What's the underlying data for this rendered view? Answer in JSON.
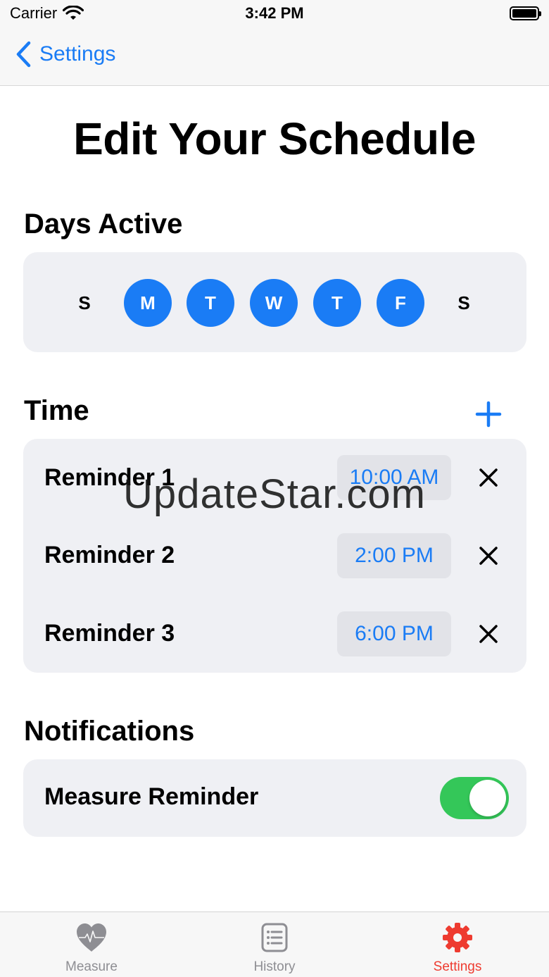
{
  "status_bar": {
    "carrier": "Carrier",
    "time": "3:42 PM",
    "wifi_icon": "wifi-icon",
    "battery_icon": "battery-icon"
  },
  "nav": {
    "back_label": "Settings",
    "back_icon": "chevron-left-icon"
  },
  "page": {
    "title": "Edit Your Schedule"
  },
  "days_section": {
    "title": "Days Active",
    "days": [
      {
        "label": "S",
        "active": false
      },
      {
        "label": "M",
        "active": true
      },
      {
        "label": "T",
        "active": true
      },
      {
        "label": "W",
        "active": true
      },
      {
        "label": "T",
        "active": true
      },
      {
        "label": "F",
        "active": true
      },
      {
        "label": "S",
        "active": false
      }
    ]
  },
  "time_section": {
    "title": "Time",
    "add_icon": "plus-icon",
    "reminders": [
      {
        "label": "Reminder 1",
        "time": "10:00 AM",
        "remove_icon": "close-icon"
      },
      {
        "label": "Reminder 2",
        "time": "2:00 PM",
        "remove_icon": "close-icon"
      },
      {
        "label": "Reminder 3",
        "time": "6:00 PM",
        "remove_icon": "close-icon"
      }
    ]
  },
  "notifications_section": {
    "title": "Notifications",
    "measure_reminder_label": "Measure Reminder",
    "measure_reminder_on": true
  },
  "watermark": "UpdateStar.com",
  "tab_bar": {
    "tabs": [
      {
        "label": "Measure",
        "icon": "heart-pulse-icon",
        "selected": false
      },
      {
        "label": "History",
        "icon": "list-icon",
        "selected": false
      },
      {
        "label": "Settings",
        "icon": "gear-icon",
        "selected": true
      }
    ]
  },
  "colors": {
    "accent": "#1a7cf5",
    "toggle_on": "#34c759",
    "tab_selected": "#ee3b30",
    "tab_unselected": "#8e8e93",
    "card_background": "#eff0f4"
  }
}
